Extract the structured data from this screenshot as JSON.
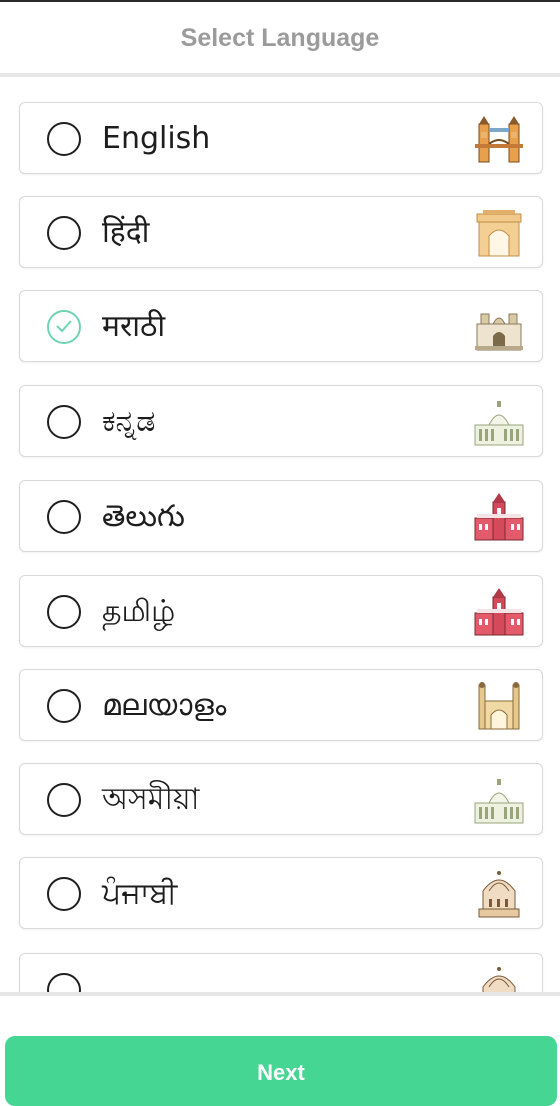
{
  "header": {
    "title": "Select Language"
  },
  "languages": [
    {
      "label": "English",
      "selected": false,
      "icon": "tower-bridge-icon"
    },
    {
      "label": "हिंदी",
      "selected": false,
      "icon": "india-gate-icon"
    },
    {
      "label": "मराठी",
      "selected": true,
      "icon": "gateway-of-india-icon"
    },
    {
      "label": "ಕನ್ನಡ",
      "selected": false,
      "icon": "vidhana-soudha-icon"
    },
    {
      "label": "తెలుగు",
      "selected": false,
      "icon": "red-building-icon"
    },
    {
      "label": "தமிழ்",
      "selected": false,
      "icon": "red-building-icon"
    },
    {
      "label": "മലയാളം",
      "selected": false,
      "icon": "charminar-icon"
    },
    {
      "label": "অসমীয়া",
      "selected": false,
      "icon": "vidhana-soudha-icon"
    },
    {
      "label": "ਪੰਜਾਬੀ",
      "selected": false,
      "icon": "temple-icon"
    }
  ],
  "footer": {
    "next_label": "Next"
  },
  "colors": {
    "accent": "#45d694",
    "check": "#6fd4b1",
    "header_text": "#9b9b9b"
  }
}
